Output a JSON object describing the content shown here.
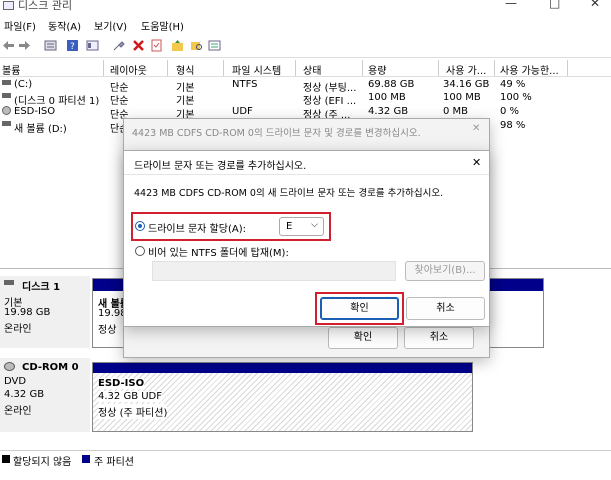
{
  "window": {
    "title": "디스크 관리",
    "minimize": "—",
    "maximize": "□",
    "close": "✕"
  },
  "menu": [
    "파일(F)",
    "동작(A)",
    "보기(V)",
    "도움말(H)"
  ],
  "columns": [
    "볼륨",
    "레이아웃",
    "형식",
    "파일 시스템",
    "상태",
    "용량",
    "사용 가...",
    "사용 가능한..."
  ],
  "volumes": [
    {
      "name": "(C:)",
      "layout": "단순",
      "type": "기본",
      "fs": "NTFS",
      "status": "정상 (부팅...",
      "capacity": "69.88 GB",
      "free": "34.16 GB",
      "pct": "49 %"
    },
    {
      "name": "(디스크 0 파티션 1)",
      "layout": "단순",
      "type": "기본",
      "fs": "",
      "status": "정상 (EFI ...",
      "capacity": "100 MB",
      "free": "100 MB",
      "pct": "100 %"
    },
    {
      "name": "ESD-ISO",
      "layout": "단순",
      "type": "기본",
      "fs": "UDF",
      "status": "정상 (주 ...",
      "capacity": "4.32 GB",
      "free": "0 MB",
      "pct": "0 %"
    },
    {
      "name": "새 볼륨 (D:)",
      "layout": "단순",
      "type": "기본",
      "fs": "",
      "status": "",
      "capacity": "",
      "free": "",
      "pct": "98 %"
    }
  ],
  "disk1": {
    "name": "디스크 1",
    "type": "기본",
    "size": "19.98 GB",
    "state": "온라인",
    "part_name": "새 볼륨",
    "part_size": "19.98",
    "part_state": "정상"
  },
  "cdrom": {
    "name": "CD-ROM 0",
    "type": "DVD",
    "size": "4.32 GB",
    "state": "온라인",
    "part_name": "ESD-ISO",
    "part_size": "4.32 GB UDF",
    "part_state": "정상 (주 파티션)"
  },
  "legend": {
    "unalloc": "할당되지 않음",
    "primary": "주 파티션"
  },
  "back_dialog": {
    "title": "4423 MB CDFS  CD-ROM 0의 드라이브 문자 및 경로를 변경하십시오.",
    "ok": "확인",
    "cancel": "취소"
  },
  "dialog": {
    "title": "드라이브 문자 또는 경로를 추가하십시오.",
    "desc": "4423 MB CDFS  CD-ROM 0의 새 드라이브 문자 또는 경로를 추가하십시오.",
    "opt1": "드라이브 문자 할당(A):",
    "drive": "E",
    "opt2": "비어 있는 NTFS 폴더에 탑재(M):",
    "browse": "찾아보기(B)...",
    "ok": "확인",
    "cancel": "취소",
    "close": "✕"
  }
}
